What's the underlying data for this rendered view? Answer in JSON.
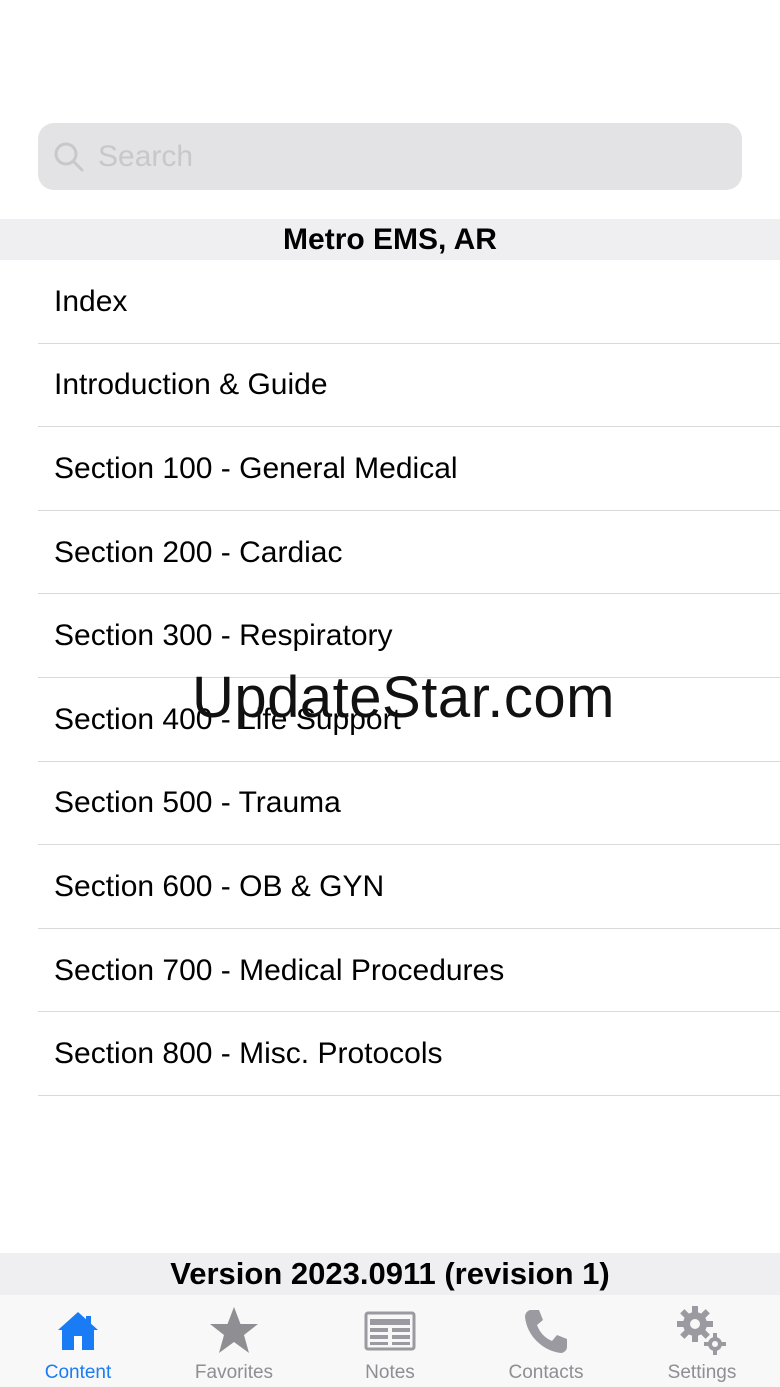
{
  "search": {
    "placeholder": "Search"
  },
  "header": {
    "title": "Metro EMS, AR"
  },
  "list": {
    "items": [
      "Index",
      "Introduction & Guide",
      "Section 100 - General Medical",
      "Section 200 - Cardiac",
      "Section 300 - Respiratory",
      "Section 400 - Life Support",
      "Section 500 - Trauma",
      "Section 600 - OB & GYN",
      "Section 700 - Medical Procedures",
      "Section 800 - Misc. Protocols"
    ]
  },
  "watermark": "UpdateStar.com",
  "footer": {
    "version": "Version 2023.0911 (revision 1)"
  },
  "tabs": [
    {
      "label": "Content",
      "icon": "house-icon",
      "active": true
    },
    {
      "label": "Favorites",
      "icon": "star-icon",
      "active": false
    },
    {
      "label": "Notes",
      "icon": "notes-icon",
      "active": false
    },
    {
      "label": "Contacts",
      "icon": "phone-icon",
      "active": false
    },
    {
      "label": "Settings",
      "icon": "gear-icon",
      "active": false
    }
  ],
  "colors": {
    "accent": "#1a7cf5",
    "inactive": "#8e8e93",
    "header_bg": "#efeff1"
  }
}
